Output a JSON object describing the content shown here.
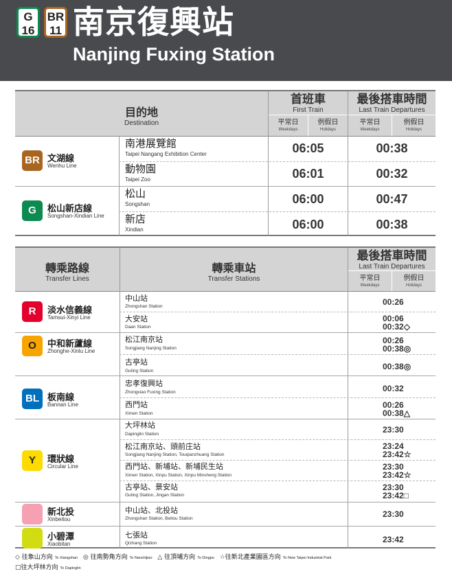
{
  "header": {
    "badges": [
      {
        "letter": "G",
        "number": "16",
        "color": "#0c8a4f"
      },
      {
        "letter": "BR",
        "number": "11",
        "color": "#a8651f"
      }
    ],
    "title_zh": "南京復興站",
    "title_en": "Nanjing Fuxing Station"
  },
  "first_last": {
    "headers": {
      "destination_zh": "目的地",
      "destination_en": "Destination",
      "first_zh": "首班車",
      "first_en": "First Train",
      "last_zh": "最後搭車時間",
      "last_en": "Last Train Departures",
      "weekdays_zh": "平常日",
      "weekdays_en": "Weekdays",
      "holidays_zh": "例假日",
      "holidays_en": "Holidays"
    },
    "lines": [
      {
        "code": "BR",
        "color": "#a8651f",
        "name_zh": "文湖線",
        "name_en": "Wenhu Line"
      },
      {
        "code": "G",
        "color": "#0c8a4f",
        "name_zh": "松山新店線",
        "name_en": "Songshan-Xindian Line"
      }
    ],
    "rows": [
      {
        "dest_zh": "南港展覽館",
        "dest_en": "Taipei Nangang Exhibition Center",
        "first": "06:05",
        "last": "00:38"
      },
      {
        "dest_zh": "動物園",
        "dest_en": "Taipei Zoo",
        "first": "06:01",
        "last": "00:32"
      },
      {
        "dest_zh": "松山",
        "dest_en": "Songshan",
        "first": "06:00",
        "last": "00:47"
      },
      {
        "dest_zh": "新店",
        "dest_en": "Xindian",
        "first": "06:00",
        "last": "00:38"
      }
    ]
  },
  "transfer": {
    "headers": {
      "lines_zh": "轉乘路線",
      "lines_en": "Transfer Lines",
      "stations_zh": "轉乘車站",
      "stations_en": "Transfer Stations",
      "last_zh": "最後搭車時間",
      "last_en": "Last Train Departures",
      "weekdays_zh": "平常日",
      "weekdays_en": "Weekdays",
      "holidays_zh": "例假日",
      "holidays_en": "Holidays"
    },
    "lines": [
      {
        "code": "R",
        "color": "#e3002c",
        "name_zh": "淡水信義線",
        "name_en": "Tamsui-Xinyi Line"
      },
      {
        "code": "O",
        "color": "#f8a400",
        "name_zh": "中和新蘆線",
        "name_en": "Zhonghe-Xinlu Line"
      },
      {
        "code": "BL",
        "color": "#0070bd",
        "name_zh": "板南線",
        "name_en": "Bannan Line"
      },
      {
        "code": "Y",
        "color": "#fddb00",
        "name_zh": "環狀線",
        "name_en": "Circular Line"
      },
      {
        "code": "",
        "color": "#f5a0b3",
        "name_zh": "新北投",
        "name_en": "Xinbeitou"
      },
      {
        "code": "",
        "color": "#d2dc13",
        "name_zh": "小碧潭",
        "name_en": "Xiaobitan"
      }
    ],
    "rows": [
      {
        "st_zh": "中山站",
        "st_en": "Zhongshan Station",
        "times": [
          "00:26"
        ]
      },
      {
        "st_zh": "大安站",
        "st_en": "Daan Station",
        "times": [
          "00:06",
          "00:32◇"
        ]
      },
      {
        "st_zh": "松江南京站",
        "st_en": "Songjiang Nanjing Station",
        "times": [
          "00:26",
          "00:38◎"
        ]
      },
      {
        "st_zh": "古亭站",
        "st_en": "Guting Station",
        "times": [
          "00:38◎"
        ]
      },
      {
        "st_zh": "忠孝復興站",
        "st_en": "Zhongxiao Fuxing Station",
        "times": [
          "00:32"
        ]
      },
      {
        "st_zh": "西門站",
        "st_en": "Ximen Station",
        "times": [
          "00:26",
          "00:38△"
        ]
      },
      {
        "st_zh": "大坪林站",
        "st_en": "Dapinglin Station",
        "times": [
          "23:30"
        ]
      },
      {
        "st_zh": "松江南京站、頭前庄站",
        "st_en": "Songjiang Nanjing Station, Touqianzhuang Station",
        "times": [
          "23:24",
          "23:42☆"
        ]
      },
      {
        "st_zh": "西門站、新埔站、新埔民生站",
        "st_en": "Ximen Station, Xinpu Station, Xinpu Minsheng Station",
        "times": [
          "23:30",
          "23:42☆"
        ]
      },
      {
        "st_zh": "古亭站、景安站",
        "st_en": "Guting Station, Jingan Station",
        "times": [
          "23:30",
          "23:42□"
        ]
      },
      {
        "st_zh": "中山站、北投站",
        "st_en": "Zhongshan Station, Beitou Station",
        "times": [
          "23:30"
        ]
      },
      {
        "st_zh": "七張站",
        "st_en": "Qizhang Station",
        "times": [
          "23:42"
        ]
      }
    ]
  },
  "legend": [
    {
      "zh": "◇ 往象山方向",
      "en": "To Xiangshan"
    },
    {
      "zh": "◎ 往南勢角方向",
      "en": "To Nanshijiao"
    },
    {
      "zh": "△ 往頂埔方向",
      "en": "To Dingpu"
    },
    {
      "zh": "☆往新北產業園區方向",
      "en": "To New Taipei Industrial Park"
    },
    {
      "zh": "□往大坪林方向",
      "en": "To Dapinglin"
    }
  ]
}
